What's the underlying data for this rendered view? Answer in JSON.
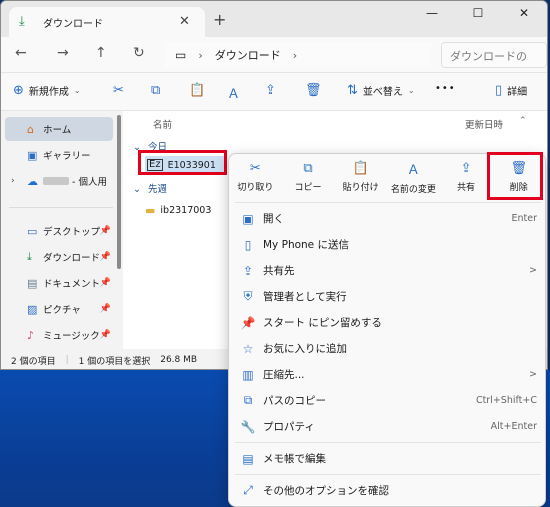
{
  "window": {
    "tab_title": "ダウンロード",
    "tab_close": "✕",
    "new_tab": "+",
    "controls": [
      "—",
      "☐",
      "✕"
    ]
  },
  "nav": {
    "back": "←",
    "forward": "→",
    "up": "↑",
    "refresh": "↻",
    "path": "ダウンロード",
    "search_placeholder": "ダウンロードの"
  },
  "toolbar": {
    "new_label": "新規作成",
    "sort_label": "並べ替え",
    "more": "•••",
    "details_label": "詳細"
  },
  "sidebar": {
    "items": [
      {
        "label": "ホーム",
        "icon": "home-icon",
        "glyph": "⌂"
      },
      {
        "label": "ギャラリー",
        "icon": "gallery-icon",
        "glyph": "▣"
      },
      {
        "label": "- 個人用",
        "icon": "onedrive-icon",
        "glyph": "☁"
      },
      {
        "label": "デスクトップ",
        "icon": "desktop-icon",
        "glyph": "▭"
      },
      {
        "label": "ダウンロード",
        "icon": "download-icon",
        "glyph": "⤓"
      },
      {
        "label": "ドキュメント",
        "icon": "document-icon",
        "glyph": "▤"
      },
      {
        "label": "ピクチャ",
        "icon": "pictures-icon",
        "glyph": "▨"
      },
      {
        "label": "ミュージック",
        "icon": "music-icon",
        "glyph": "♪"
      }
    ],
    "pin": "📌"
  },
  "content": {
    "col_name": "名前",
    "col_date": "更新日時",
    "group_today": "今日",
    "file1": "E1033901",
    "group_lastweek": "先週",
    "file2": "ib2317003"
  },
  "status": {
    "count": "2 個の項目",
    "selected": "1 個の項目を選択",
    "size": "26.8 MB"
  },
  "context": {
    "quick": [
      {
        "label": "切り取り",
        "glyph": "✂",
        "name": "cut"
      },
      {
        "label": "コピー",
        "glyph": "⧉",
        "name": "copy"
      },
      {
        "label": "貼り付け",
        "glyph": "📋",
        "name": "paste"
      },
      {
        "label": "名前の変更",
        "glyph": "Ａ",
        "name": "rename"
      },
      {
        "label": "共有",
        "glyph": "⇪",
        "name": "share"
      },
      {
        "label": "削除",
        "glyph": "🗑",
        "name": "delete"
      }
    ],
    "items": [
      {
        "label": "開く",
        "shortcut": "Enter",
        "glyph": "▣",
        "name": "open"
      },
      {
        "label": "My Phone に送信",
        "shortcut": "",
        "glyph": "▯",
        "name": "send-to-phone"
      },
      {
        "label": "共有先",
        "shortcut": ">",
        "glyph": "⇪",
        "name": "share-to"
      },
      {
        "label": "管理者として実行",
        "shortcut": "",
        "glyph": "⛨",
        "name": "run-as-admin"
      },
      {
        "label": "スタート にピン留めする",
        "shortcut": "",
        "glyph": "📌",
        "name": "pin-to-start"
      },
      {
        "label": "お気に入りに追加",
        "shortcut": "",
        "glyph": "☆",
        "name": "add-favorite"
      },
      {
        "label": "圧縮先...",
        "shortcut": ">",
        "glyph": "▥",
        "name": "compress"
      },
      {
        "label": "パスのコピー",
        "shortcut": "Ctrl+Shift+C",
        "glyph": "⧉",
        "name": "copy-path"
      },
      {
        "label": "プロパティ",
        "shortcut": "Alt+Enter",
        "glyph": "🔧",
        "name": "properties"
      },
      {
        "label": "メモ帳で編集",
        "shortcut": "",
        "glyph": "▤",
        "name": "edit-notepad"
      },
      {
        "label": "その他のオプションを確認",
        "shortcut": "",
        "glyph": "⤢",
        "name": "more-options"
      }
    ]
  }
}
